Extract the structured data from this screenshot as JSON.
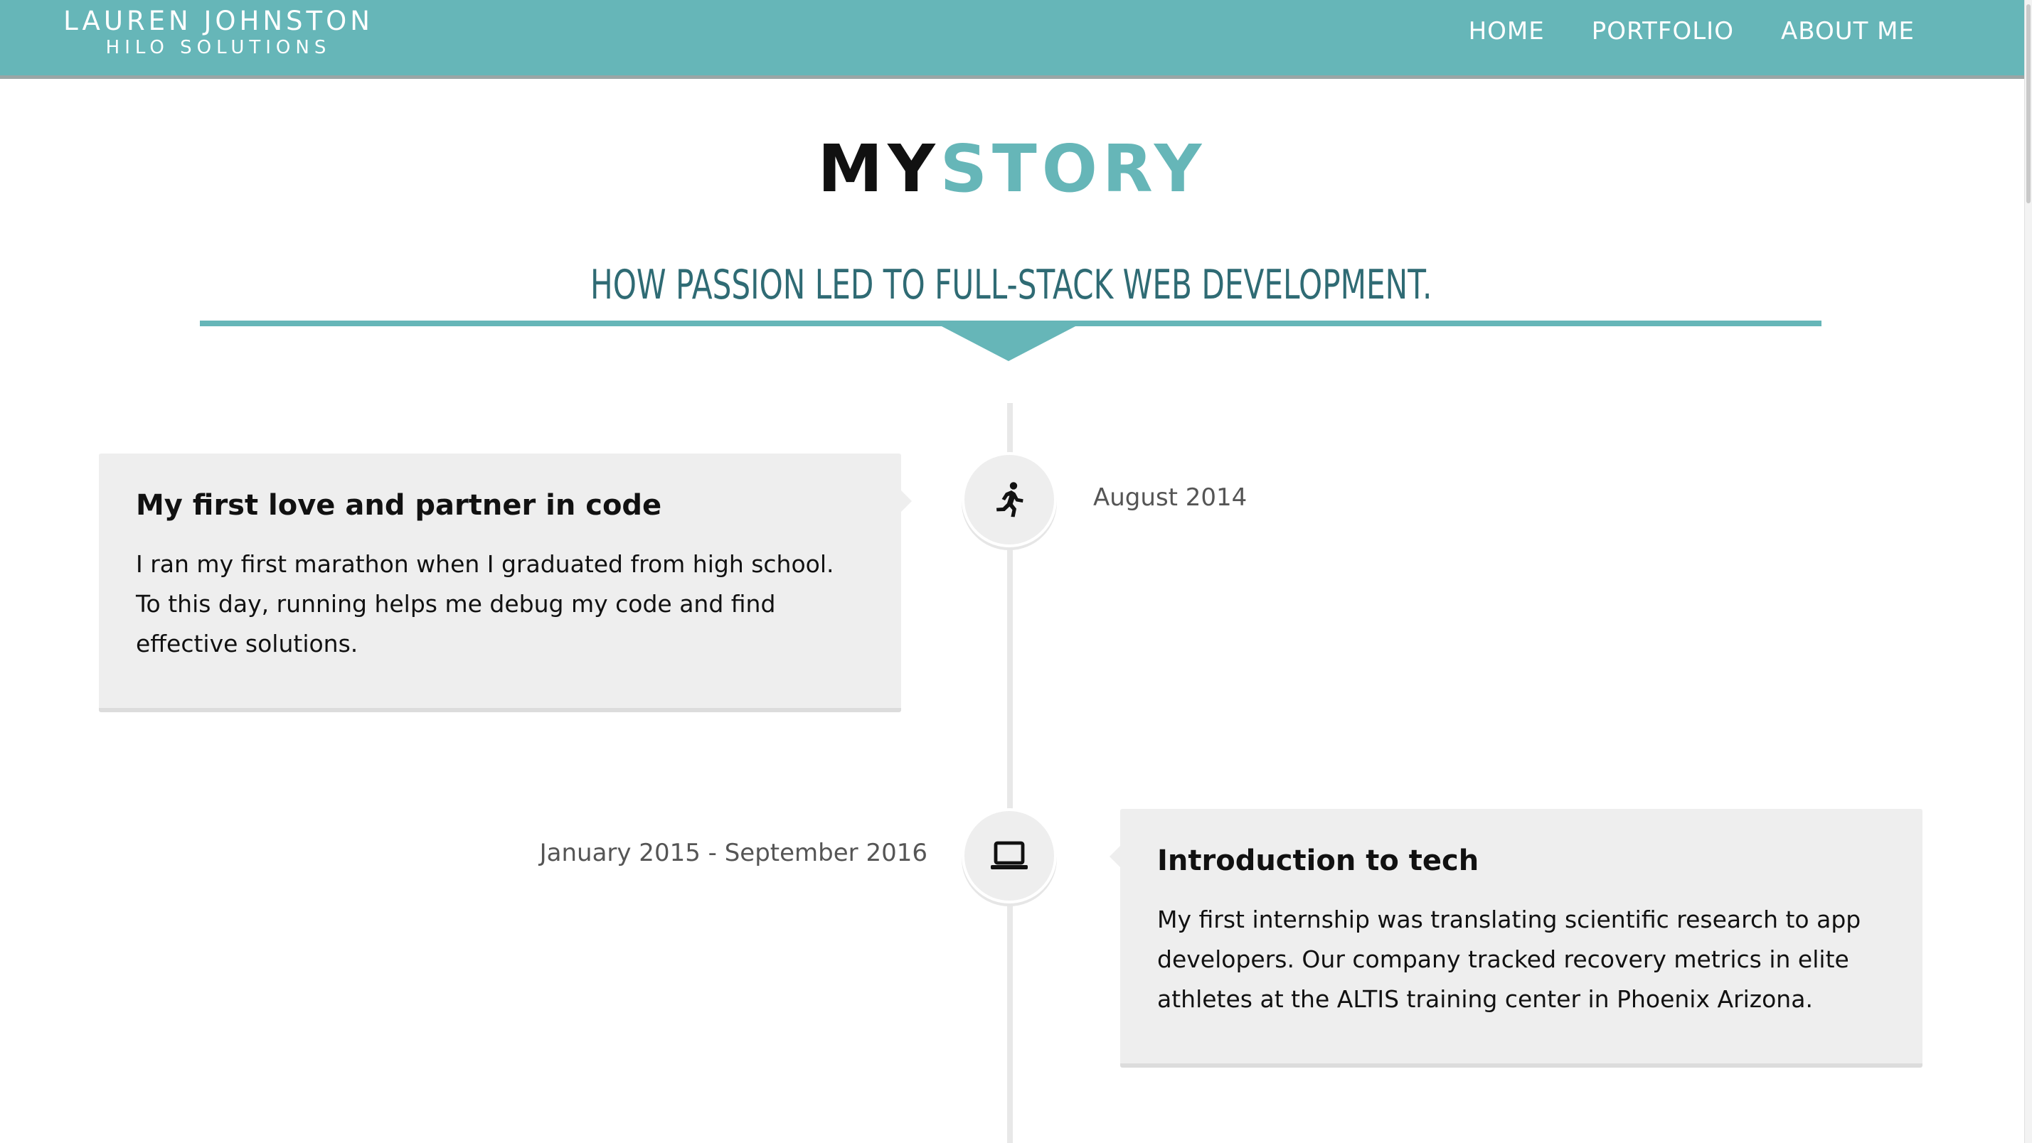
{
  "header": {
    "brand_name": "LAUREN JOHNSTON",
    "brand_sub": "HILO SOLUTIONS",
    "nav": [
      {
        "label": "HOME"
      },
      {
        "label": "PORTFOLIO"
      },
      {
        "label": "ABOUT ME"
      }
    ],
    "background_color": "#66b6b8"
  },
  "main": {
    "title_part1": "MY",
    "title_part2": "STORY",
    "subtitle": "HOW PASSION LED TO FULL-STACK WEB DEVELOPMENT.",
    "accent_color": "#66b6b8"
  },
  "timeline": [
    {
      "icon": "running-icon",
      "date": "August 2014",
      "title": "My first love and partner in code",
      "text": "I ran my first marathon when I graduated from high school. To this day, running helps me debug my code and find effective solutions."
    },
    {
      "icon": "laptop-icon",
      "date": "January 2015 - September 2016",
      "title": "Introduction to tech",
      "text": "My first internship was translating scientific research to app developers. Our company tracked recovery metrics in elite athletes at the ALTIS training center in Phoenix Arizona."
    }
  ]
}
